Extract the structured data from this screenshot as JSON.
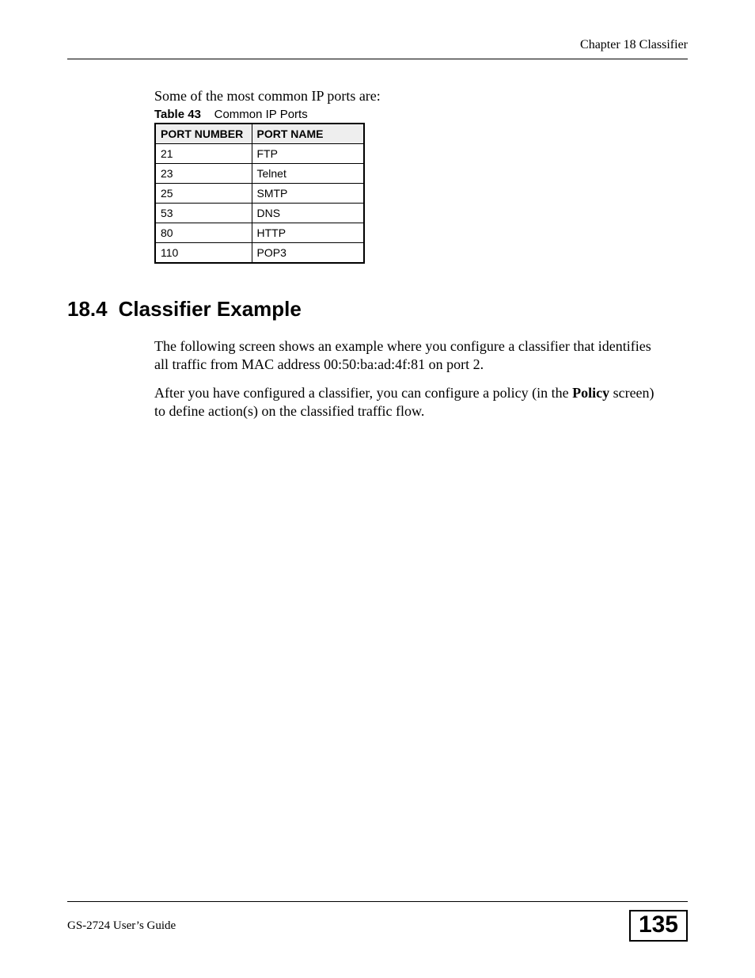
{
  "header": {
    "chapter": "Chapter 18 Classifier"
  },
  "intro": "Some of the most common IP ports are:",
  "table": {
    "caption_label": "Table 43",
    "caption_text": "Common IP Ports",
    "headers": [
      "PORT NUMBER",
      "PORT NAME"
    ],
    "rows": [
      {
        "num": "21",
        "name": "FTP"
      },
      {
        "num": "23",
        "name": "Telnet"
      },
      {
        "num": "25",
        "name": "SMTP"
      },
      {
        "num": "53",
        "name": "DNS"
      },
      {
        "num": "80",
        "name": "HTTP"
      },
      {
        "num": "110",
        "name": "POP3"
      }
    ]
  },
  "section": {
    "number": "18.4",
    "title": "Classifier Example",
    "para1": "The following screen shows an example where you configure a classifier that identifies all traffic from MAC address 00:50:ba:ad:4f:81 on port 2.",
    "para2_a": "After you have configured a classifier, you can configure a policy (in the ",
    "para2_bold": "Policy",
    "para2_b": " screen) to define action(s) on the classified traffic flow."
  },
  "footer": {
    "guide": "GS-2724 User’s Guide",
    "page": "135"
  }
}
